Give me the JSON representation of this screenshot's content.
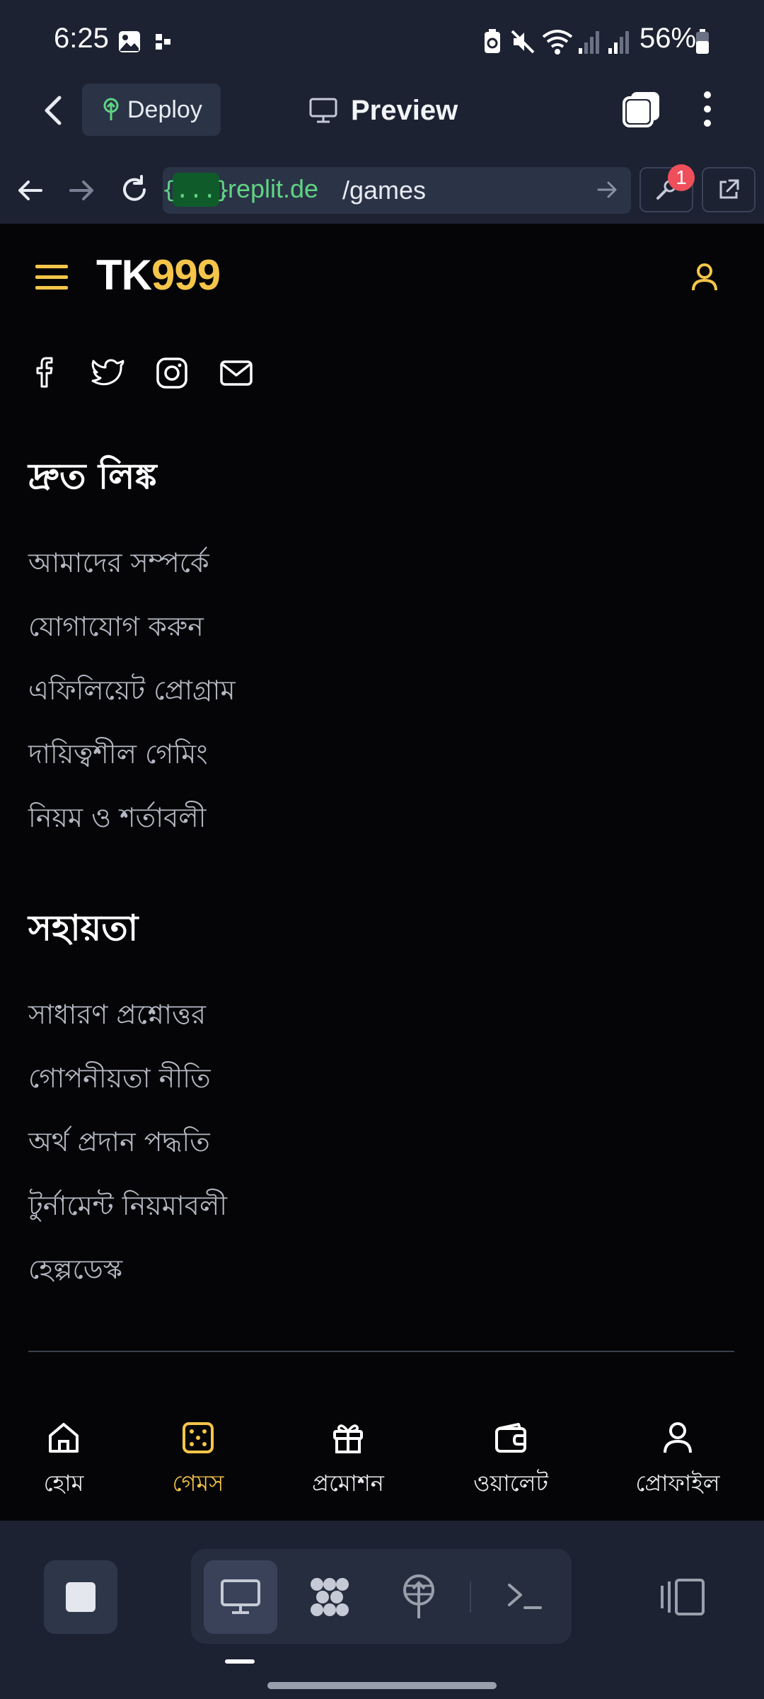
{
  "status_bar": {
    "time": "6:25",
    "battery": "56%",
    "icons": [
      "image-icon",
      "grid-icon",
      "battery-saver-icon",
      "mute-icon",
      "wifi-icon",
      "signal-icon",
      "signal-icon",
      "battery-icon"
    ]
  },
  "replit_header": {
    "deploy_label": "Deploy",
    "title": "Preview"
  },
  "url_bar": {
    "chip": "{...}",
    "host": ".replit.de",
    "path": "/games",
    "badge_count": "1"
  },
  "site": {
    "logo_part1": "TK",
    "logo_part2": "999",
    "social_icons": [
      "facebook-icon",
      "twitter-icon",
      "instagram-icon",
      "mail-icon"
    ],
    "quick_links": {
      "title": "দ্রুত লিঙ্ক",
      "items": [
        "আমাদের সম্পর্কে",
        "যোগাযোগ করুন",
        "এফিলিয়েট প্রোগ্রাম",
        "দায়িত্বশীল গেমিং",
        "নিয়ম ও শর্তাবলী"
      ]
    },
    "support": {
      "title": "সহায়তা",
      "items": [
        "সাধারণ প্রশ্নোত্তর",
        "গোপনীয়তা নীতি",
        "অর্থ প্রদান পদ্ধতি",
        "টুর্নামেন্ট নিয়মাবলী",
        "হেল্পডেস্ক"
      ]
    }
  },
  "bottom_nav": [
    {
      "label": "হোম",
      "icon": "home-icon",
      "active": false
    },
    {
      "label": "গেমস",
      "icon": "dice-icon",
      "active": true
    },
    {
      "label": "প্রমোশন",
      "icon": "gift-icon",
      "active": false
    },
    {
      "label": "ওয়ালেট",
      "icon": "wallet-icon",
      "active": false
    },
    {
      "label": "প্রোফাইল",
      "icon": "user-icon",
      "active": false
    }
  ],
  "colors": {
    "accent": "#f5c54a",
    "site_bg": "#050507",
    "ide_bg": "#1c2232",
    "url_green": "#5fd483"
  }
}
